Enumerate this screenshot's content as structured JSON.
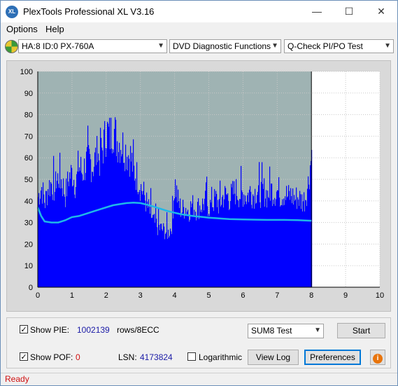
{
  "window": {
    "title": "PlexTools Professional XL V3.16",
    "icon_text": "XL"
  },
  "menu": [
    {
      "label": "Options",
      "underline": "O"
    },
    {
      "label": "Help",
      "underline": "H"
    }
  ],
  "toolbar": {
    "drive": "HA:8 ID:0  PX-760A",
    "function": "DVD Diagnostic Functions",
    "test": "Q-Check PI/PO Test"
  },
  "chart_data": {
    "type": "bar",
    "x_ticks": [
      "0",
      "1",
      "2",
      "3",
      "4",
      "5",
      "6",
      "7",
      "8",
      "9",
      "10"
    ],
    "y_ticks": [
      "0",
      "10",
      "20",
      "30",
      "40",
      "50",
      "60",
      "70",
      "80",
      "90",
      "100"
    ],
    "xlim": [
      0,
      10
    ],
    "ylim": [
      0,
      100
    ],
    "grid": true,
    "data_end_x": 8.0,
    "bar_color": "#0000ff",
    "line_color": "#1fb8e8",
    "plot_bg": "#9fb3b3",
    "bars_envelope": [
      {
        "x": 0.0,
        "y": 45
      },
      {
        "x": 0.1,
        "y": 50
      },
      {
        "x": 0.2,
        "y": 42
      },
      {
        "x": 0.3,
        "y": 50
      },
      {
        "x": 0.4,
        "y": 52
      },
      {
        "x": 0.5,
        "y": 48
      },
      {
        "x": 0.6,
        "y": 56
      },
      {
        "x": 0.7,
        "y": 52
      },
      {
        "x": 0.8,
        "y": 46
      },
      {
        "x": 0.9,
        "y": 55
      },
      {
        "x": 1.0,
        "y": 57
      },
      {
        "x": 1.1,
        "y": 51
      },
      {
        "x": 1.2,
        "y": 60
      },
      {
        "x": 1.3,
        "y": 57
      },
      {
        "x": 1.4,
        "y": 62
      },
      {
        "x": 1.5,
        "y": 64
      },
      {
        "x": 1.6,
        "y": 60
      },
      {
        "x": 1.7,
        "y": 66
      },
      {
        "x": 1.8,
        "y": 64
      },
      {
        "x": 1.9,
        "y": 70
      },
      {
        "x": 2.0,
        "y": 78
      },
      {
        "x": 2.1,
        "y": 75
      },
      {
        "x": 2.2,
        "y": 80
      },
      {
        "x": 2.3,
        "y": 73
      },
      {
        "x": 2.4,
        "y": 72
      },
      {
        "x": 2.5,
        "y": 70
      },
      {
        "x": 2.6,
        "y": 67
      },
      {
        "x": 2.7,
        "y": 65
      },
      {
        "x": 2.8,
        "y": 58
      },
      {
        "x": 2.9,
        "y": 55
      },
      {
        "x": 3.0,
        "y": 50
      },
      {
        "x": 3.1,
        "y": 46
      },
      {
        "x": 3.2,
        "y": 40
      },
      {
        "x": 3.3,
        "y": 36
      },
      {
        "x": 3.4,
        "y": 32
      },
      {
        "x": 3.5,
        "y": 30
      },
      {
        "x": 3.6,
        "y": 29
      },
      {
        "x": 3.7,
        "y": 28
      },
      {
        "x": 3.8,
        "y": 27
      },
      {
        "x": 3.9,
        "y": 30
      },
      {
        "x": 4.0,
        "y": 52
      },
      {
        "x": 4.1,
        "y": 42
      },
      {
        "x": 4.2,
        "y": 38
      },
      {
        "x": 4.3,
        "y": 40
      },
      {
        "x": 4.4,
        "y": 38
      },
      {
        "x": 4.5,
        "y": 41
      },
      {
        "x": 4.6,
        "y": 39
      },
      {
        "x": 4.7,
        "y": 40
      },
      {
        "x": 4.8,
        "y": 41
      },
      {
        "x": 4.9,
        "y": 43
      },
      {
        "x": 5.0,
        "y": 40
      },
      {
        "x": 5.1,
        "y": 42
      },
      {
        "x": 5.2,
        "y": 44
      },
      {
        "x": 5.3,
        "y": 41
      },
      {
        "x": 5.4,
        "y": 45
      },
      {
        "x": 5.5,
        "y": 46
      },
      {
        "x": 5.6,
        "y": 44
      },
      {
        "x": 5.7,
        "y": 47
      },
      {
        "x": 5.8,
        "y": 48
      },
      {
        "x": 5.9,
        "y": 46
      },
      {
        "x": 6.0,
        "y": 47
      },
      {
        "x": 6.1,
        "y": 45
      },
      {
        "x": 6.2,
        "y": 48
      },
      {
        "x": 6.3,
        "y": 46
      },
      {
        "x": 6.4,
        "y": 49
      },
      {
        "x": 6.5,
        "y": 47
      },
      {
        "x": 6.6,
        "y": 48
      },
      {
        "x": 6.7,
        "y": 46
      },
      {
        "x": 6.8,
        "y": 49
      },
      {
        "x": 6.9,
        "y": 47
      },
      {
        "x": 7.0,
        "y": 48
      },
      {
        "x": 7.1,
        "y": 46
      },
      {
        "x": 7.2,
        "y": 47
      },
      {
        "x": 7.3,
        "y": 45
      },
      {
        "x": 7.4,
        "y": 46
      },
      {
        "x": 7.5,
        "y": 44
      },
      {
        "x": 7.6,
        "y": 45
      },
      {
        "x": 7.7,
        "y": 43
      },
      {
        "x": 7.8,
        "y": 44
      },
      {
        "x": 7.9,
        "y": 52
      },
      {
        "x": 8.0,
        "y": 68
      }
    ],
    "line_points": [
      {
        "x": 0.0,
        "y": 37
      },
      {
        "x": 0.1,
        "y": 33
      },
      {
        "x": 0.2,
        "y": 30.5
      },
      {
        "x": 0.4,
        "y": 30
      },
      {
        "x": 0.6,
        "y": 30
      },
      {
        "x": 0.8,
        "y": 31
      },
      {
        "x": 1.0,
        "y": 32.5
      },
      {
        "x": 1.2,
        "y": 33
      },
      {
        "x": 1.4,
        "y": 34
      },
      {
        "x": 1.6,
        "y": 35
      },
      {
        "x": 1.8,
        "y": 36
      },
      {
        "x": 2.0,
        "y": 37
      },
      {
        "x": 2.2,
        "y": 38
      },
      {
        "x": 2.4,
        "y": 38.5
      },
      {
        "x": 2.6,
        "y": 39
      },
      {
        "x": 2.8,
        "y": 39.2
      },
      {
        "x": 3.0,
        "y": 39
      },
      {
        "x": 3.2,
        "y": 38.2
      },
      {
        "x": 3.4,
        "y": 37.3
      },
      {
        "x": 3.6,
        "y": 36.3
      },
      {
        "x": 3.8,
        "y": 35.3
      },
      {
        "x": 4.0,
        "y": 34.5
      },
      {
        "x": 4.2,
        "y": 33.8
      },
      {
        "x": 4.4,
        "y": 33.3
      },
      {
        "x": 4.6,
        "y": 32.9
      },
      {
        "x": 4.8,
        "y": 32.6
      },
      {
        "x": 5.0,
        "y": 32.2
      },
      {
        "x": 5.2,
        "y": 32
      },
      {
        "x": 5.4,
        "y": 31.8
      },
      {
        "x": 5.6,
        "y": 31.6
      },
      {
        "x": 5.8,
        "y": 31.5
      },
      {
        "x": 6.0,
        "y": 31.4
      },
      {
        "x": 6.4,
        "y": 31.3
      },
      {
        "x": 6.8,
        "y": 31.2
      },
      {
        "x": 7.2,
        "y": 31.2
      },
      {
        "x": 7.6,
        "y": 31.1
      },
      {
        "x": 8.0,
        "y": 30.8
      }
    ]
  },
  "controls": {
    "show_pie_label": "Show PIE:",
    "pie_value": "1002139",
    "rows_label": "rows/8ECC",
    "show_pof_label": "Show POF:",
    "pof_value": "0",
    "lsn_label": "LSN:",
    "lsn_value": "4173824",
    "logarithmic_label": "Logarithmic",
    "sum_select": "SUM8 Test",
    "start_label": "Start",
    "viewlog_label": "View Log",
    "preferences_label": "Preferences",
    "show_pie_checked": true,
    "show_pof_checked": true,
    "logarithmic_checked": false
  },
  "status": {
    "text": "Ready"
  }
}
